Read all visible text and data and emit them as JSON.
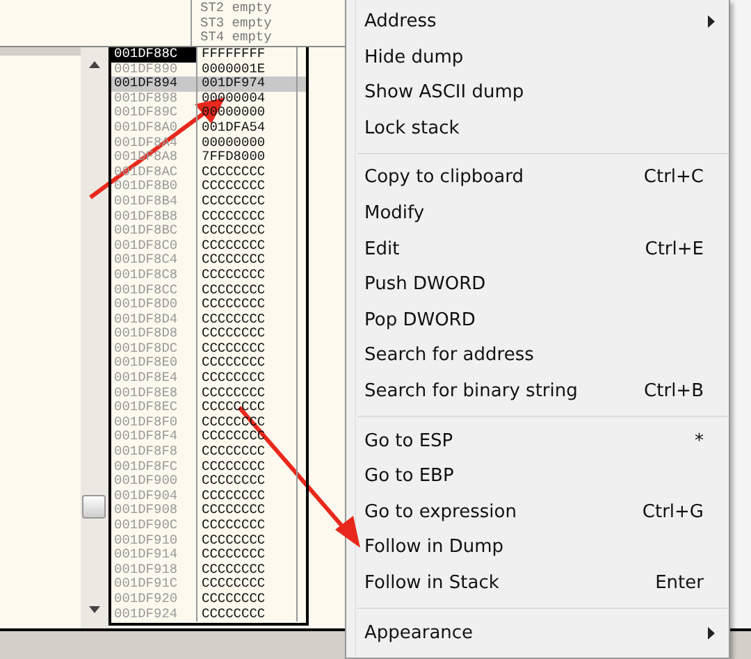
{
  "fpu": {
    "lines": [
      "ST2 empty",
      "ST3 empty",
      "ST4 empty"
    ]
  },
  "stack": {
    "rows": [
      {
        "address": "001DF88C",
        "value": "FFFFFFFF",
        "selected": true,
        "highlighted": false
      },
      {
        "address": "001DF890",
        "value": "0000001E",
        "selected": false,
        "highlighted": false
      },
      {
        "address": "001DF894",
        "value": "001DF974",
        "selected": false,
        "highlighted": true
      },
      {
        "address": "001DF898",
        "value": "00000004",
        "selected": false,
        "highlighted": false
      },
      {
        "address": "001DF89C",
        "value": "00000000",
        "selected": false,
        "highlighted": false
      },
      {
        "address": "001DF8A0",
        "value": "001DFA54",
        "selected": false,
        "highlighted": false
      },
      {
        "address": "001DF8A4",
        "value": "00000000",
        "selected": false,
        "highlighted": false
      },
      {
        "address": "001DF8A8",
        "value": "7FFD8000",
        "selected": false,
        "highlighted": false
      },
      {
        "address": "001DF8AC",
        "value": "CCCCCCCC",
        "selected": false,
        "highlighted": false
      },
      {
        "address": "001DF8B0",
        "value": "CCCCCCCC",
        "selected": false,
        "highlighted": false
      },
      {
        "address": "001DF8B4",
        "value": "CCCCCCCC",
        "selected": false,
        "highlighted": false
      },
      {
        "address": "001DF8B8",
        "value": "CCCCCCCC",
        "selected": false,
        "highlighted": false
      },
      {
        "address": "001DF8BC",
        "value": "CCCCCCCC",
        "selected": false,
        "highlighted": false
      },
      {
        "address": "001DF8C0",
        "value": "CCCCCCCC",
        "selected": false,
        "highlighted": false
      },
      {
        "address": "001DF8C4",
        "value": "CCCCCCCC",
        "selected": false,
        "highlighted": false
      },
      {
        "address": "001DF8C8",
        "value": "CCCCCCCC",
        "selected": false,
        "highlighted": false
      },
      {
        "address": "001DF8CC",
        "value": "CCCCCCCC",
        "selected": false,
        "highlighted": false
      },
      {
        "address": "001DF8D0",
        "value": "CCCCCCCC",
        "selected": false,
        "highlighted": false
      },
      {
        "address": "001DF8D4",
        "value": "CCCCCCCC",
        "selected": false,
        "highlighted": false
      },
      {
        "address": "001DF8D8",
        "value": "CCCCCCCC",
        "selected": false,
        "highlighted": false
      },
      {
        "address": "001DF8DC",
        "value": "CCCCCCCC",
        "selected": false,
        "highlighted": false
      },
      {
        "address": "001DF8E0",
        "value": "CCCCCCCC",
        "selected": false,
        "highlighted": false
      },
      {
        "address": "001DF8E4",
        "value": "CCCCCCCC",
        "selected": false,
        "highlighted": false
      },
      {
        "address": "001DF8E8",
        "value": "CCCCCCCC",
        "selected": false,
        "highlighted": false
      },
      {
        "address": "001DF8EC",
        "value": "CCCCCCCC",
        "selected": false,
        "highlighted": false
      },
      {
        "address": "001DF8F0",
        "value": "CCCCCCCC",
        "selected": false,
        "highlighted": false
      },
      {
        "address": "001DF8F4",
        "value": "CCCCCCCC",
        "selected": false,
        "highlighted": false
      },
      {
        "address": "001DF8F8",
        "value": "CCCCCCCC",
        "selected": false,
        "highlighted": false
      },
      {
        "address": "001DF8FC",
        "value": "CCCCCCCC",
        "selected": false,
        "highlighted": false
      },
      {
        "address": "001DF900",
        "value": "CCCCCCCC",
        "selected": false,
        "highlighted": false
      },
      {
        "address": "001DF904",
        "value": "CCCCCCCC",
        "selected": false,
        "highlighted": false
      },
      {
        "address": "001DF908",
        "value": "CCCCCCCC",
        "selected": false,
        "highlighted": false
      },
      {
        "address": "001DF90C",
        "value": "CCCCCCCC",
        "selected": false,
        "highlighted": false
      },
      {
        "address": "001DF910",
        "value": "CCCCCCCC",
        "selected": false,
        "highlighted": false
      },
      {
        "address": "001DF914",
        "value": "CCCCCCCC",
        "selected": false,
        "highlighted": false
      },
      {
        "address": "001DF918",
        "value": "CCCCCCCC",
        "selected": false,
        "highlighted": false
      },
      {
        "address": "001DF91C",
        "value": "CCCCCCCC",
        "selected": false,
        "highlighted": false
      },
      {
        "address": "001DF920",
        "value": "CCCCCCCC",
        "selected": false,
        "highlighted": false
      },
      {
        "address": "001DF924",
        "value": "CCCCCCCC",
        "selected": false,
        "highlighted": false
      }
    ]
  },
  "context_menu": {
    "groups": [
      {
        "items": [
          {
            "label": "Address",
            "submenu": true
          },
          {
            "label": "Hide dump",
            "submenu": false
          },
          {
            "label": "Show ASCII dump",
            "submenu": false
          },
          {
            "label": "Lock stack",
            "submenu": false
          }
        ]
      },
      {
        "items": [
          {
            "label": "Copy to clipboard",
            "shortcut": "Ctrl+C",
            "submenu": false
          },
          {
            "label": "Modify",
            "submenu": false
          },
          {
            "label": "Edit",
            "shortcut": "Ctrl+E",
            "submenu": false
          },
          {
            "label": "Push DWORD",
            "submenu": false
          },
          {
            "label": "Pop DWORD",
            "submenu": false
          },
          {
            "label": "Search for address",
            "submenu": false
          },
          {
            "label": "Search for binary string",
            "shortcut": "Ctrl+B",
            "submenu": false
          }
        ]
      },
      {
        "items": [
          {
            "label": "Go to ESP",
            "shortcut": "*",
            "submenu": false
          },
          {
            "label": "Go to EBP",
            "submenu": false
          },
          {
            "label": "Go to expression",
            "shortcut": "Ctrl+G",
            "submenu": false
          },
          {
            "label": "Follow in Dump",
            "submenu": false
          },
          {
            "label": "Follow in Stack",
            "shortcut": "Enter",
            "submenu": false
          }
        ]
      },
      {
        "items": [
          {
            "label": "Appearance",
            "submenu": true
          }
        ]
      }
    ]
  }
}
